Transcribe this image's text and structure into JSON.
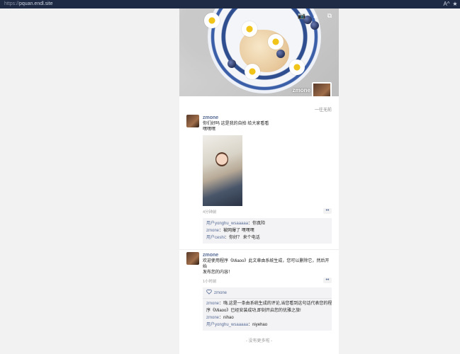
{
  "browser": {
    "url_protocol": "https://",
    "url_host": "pquan.endl.site",
    "icons": [
      "reader-mode-icon",
      "favorites-star-icon"
    ],
    "reader_label": "A^"
  },
  "profile": {
    "name": "zmone",
    "signature": "一往无前",
    "cover_icons": [
      "camera-icon",
      "upload-icon",
      "share-icon"
    ]
  },
  "posts": [
    {
      "name": "zmone",
      "text_lines": [
        "你们好吗 这是我的自拍 给大家看看",
        "嘿嘿嘿"
      ],
      "time": "4分钟前",
      "more": "••",
      "comments": [
        {
          "who": "用户yonghu_wsaaaaa",
          "sep": "：",
          "text": "你真险"
        },
        {
          "who": "zmone",
          "sep": "：",
          "text": "被网爆了 嘿嘿嘿"
        },
        {
          "who": "用户ceshi",
          "sep": "：",
          "text": "你好？ 来个电话"
        }
      ]
    },
    {
      "name": "zmone",
      "text_lines": [
        "欢迎使用程序《Miaoo》此文章由系统生成，您可以删除它，然后开始",
        "发布您的内容！"
      ],
      "time": "1小时前",
      "more": "••",
      "likes": "zmone",
      "comments": [
        {
          "who": "zmone",
          "sep": "：",
          "text": "嗨,这是一条由系统生成的评论,当您看到这句话代表您的程"
        },
        {
          "who": "",
          "sep": "",
          "text": "序《Miaoo》已经安装成功,即刻开启您的优雅之旅!"
        },
        {
          "who": "zmone",
          "sep": "：",
          "text": "nihao"
        },
        {
          "who": "用户yonghu_wsaaaaa",
          "sep": "：",
          "text": "niyehao"
        }
      ]
    }
  ],
  "footer": "- 没有更多啦 -"
}
